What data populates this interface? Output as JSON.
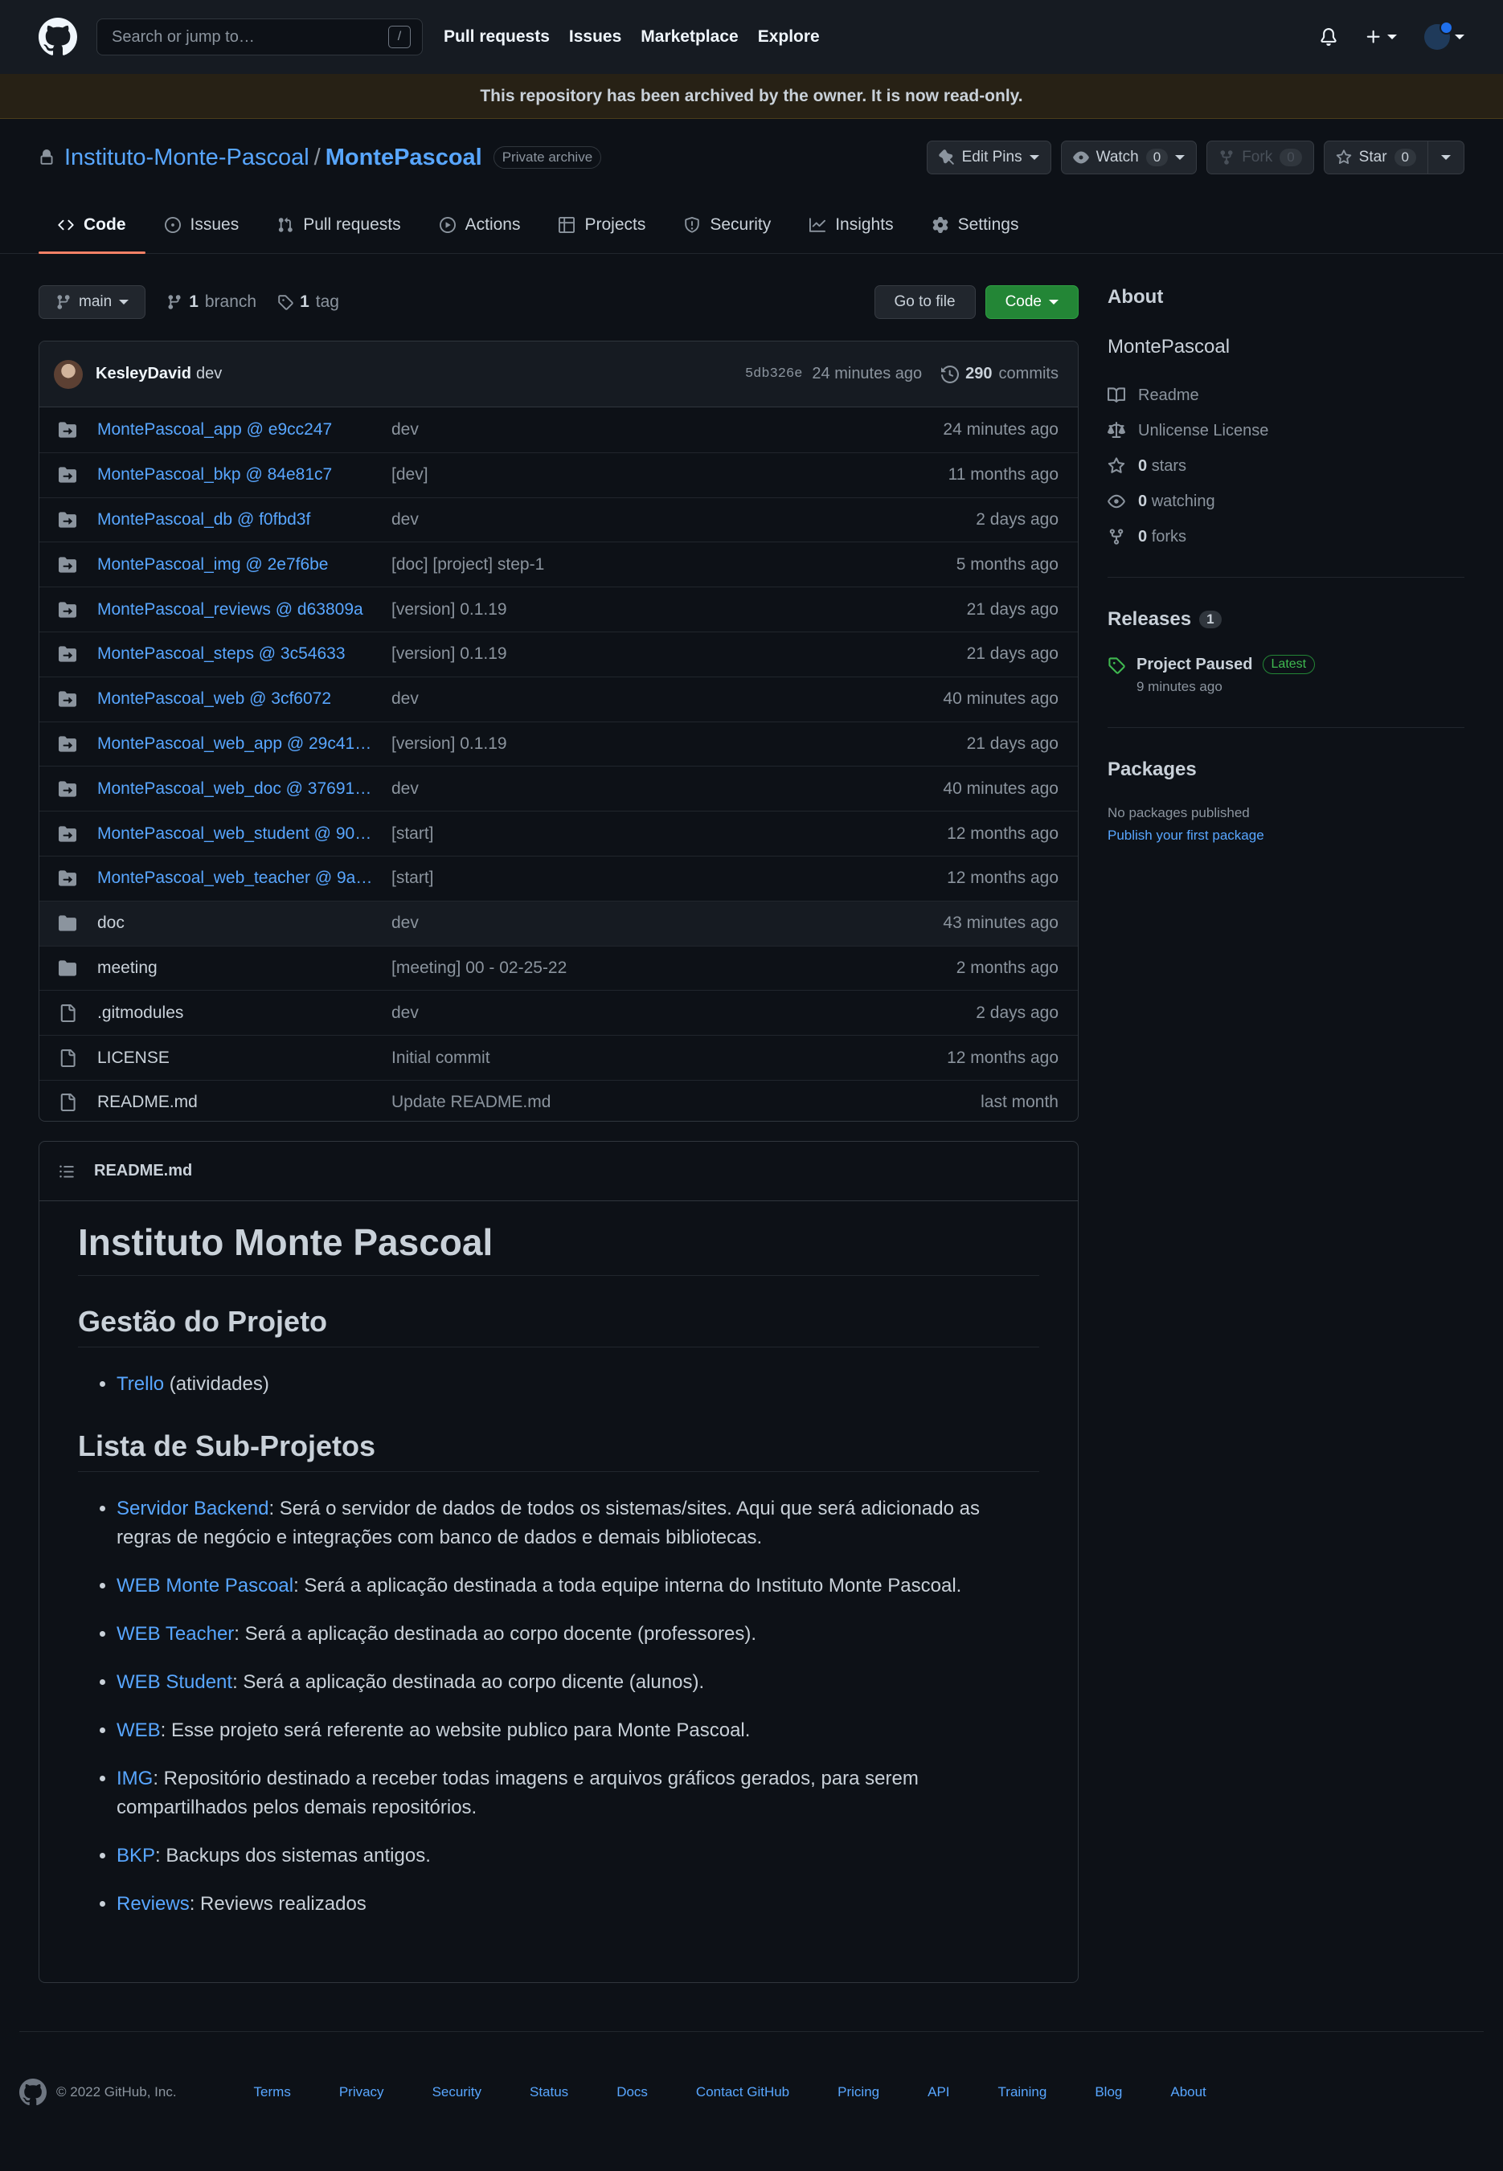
{
  "header": {
    "search_placeholder": "Search or jump to…",
    "search_key": "/",
    "nav": [
      "Pull requests",
      "Issues",
      "Marketplace",
      "Explore"
    ]
  },
  "banner": "This repository has been archived by the owner. It is now read-only.",
  "repo": {
    "owner": "Instituto-Monte-Pascoal",
    "separator": "/",
    "name": "MontePascoal",
    "visibility": "Private archive",
    "edit_pins": "Edit Pins",
    "watch": "Watch",
    "watch_count": "0",
    "fork": "Fork",
    "fork_count": "0",
    "star": "Star",
    "star_count": "0"
  },
  "tabs": [
    "Code",
    "Issues",
    "Pull requests",
    "Actions",
    "Projects",
    "Security",
    "Insights",
    "Settings"
  ],
  "filenav": {
    "branch": "main",
    "branch_count": "1",
    "branch_label": "branch",
    "tag_count": "1",
    "tag_label": "tag",
    "go_to_file": "Go to file",
    "code": "Code"
  },
  "latest_commit": {
    "author": "KesleyDavid",
    "message": "dev",
    "sha": "5db326e",
    "time": "24 minutes ago",
    "commit_count": "290",
    "commit_label": "commits"
  },
  "files": [
    {
      "type": "submodule",
      "name": "MontePascoal_app @ e9cc247",
      "message": "dev",
      "age": "24 minutes ago"
    },
    {
      "type": "submodule",
      "name": "MontePascoal_bkp @ 84e81c7",
      "message": "[dev]",
      "age": "11 months ago"
    },
    {
      "type": "submodule",
      "name": "MontePascoal_db @ f0fbd3f",
      "message": "dev",
      "age": "2 days ago"
    },
    {
      "type": "submodule",
      "name": "MontePascoal_img @ 2e7f6be",
      "message": "[doc] [project] step-1",
      "age": "5 months ago"
    },
    {
      "type": "submodule",
      "name": "MontePascoal_reviews @ d63809a",
      "message": "[version] 0.1.19",
      "age": "21 days ago"
    },
    {
      "type": "submodule",
      "name": "MontePascoal_steps @ 3c54633",
      "message": "[version] 0.1.19",
      "age": "21 days ago"
    },
    {
      "type": "submodule",
      "name": "MontePascoal_web @ 3cf6072",
      "message": "dev",
      "age": "40 minutes ago"
    },
    {
      "type": "submodule",
      "name": "MontePascoal_web_app @ 29c41…",
      "message": "[version] 0.1.19",
      "age": "21 days ago"
    },
    {
      "type": "submodule",
      "name": "MontePascoal_web_doc @ 37691…",
      "message": "dev",
      "age": "40 minutes ago"
    },
    {
      "type": "submodule",
      "name": "MontePascoal_web_student @ 90…",
      "message": "[start]",
      "age": "12 months ago"
    },
    {
      "type": "submodule",
      "name": "MontePascoal_web_teacher @ 9a…",
      "message": "[start]",
      "age": "12 months ago"
    },
    {
      "type": "folder",
      "name": "doc",
      "message": "dev",
      "age": "43 minutes ago"
    },
    {
      "type": "folder",
      "name": "meeting",
      "message": "[meeting] 00 - 02-25-22",
      "age": "2 months ago"
    },
    {
      "type": "file",
      "name": ".gitmodules",
      "message": "dev",
      "age": "2 days ago"
    },
    {
      "type": "file",
      "name": "LICENSE",
      "message": "Initial commit",
      "age": "12 months ago"
    },
    {
      "type": "file",
      "name": "README.md",
      "message": "Update README.md",
      "age": "last month"
    }
  ],
  "readme": {
    "filename": "README.md",
    "h1": "Instituto Monte Pascoal",
    "h2_management": "Gestão do Projeto",
    "management_items": [
      {
        "link": "Trello",
        "text": " (atividades)"
      }
    ],
    "h2_subprojects": "Lista de Sub-Projetos",
    "subprojects": [
      {
        "link": "Servidor Backend",
        "text": ": Será o servidor de dados de todos os sistemas/sites. Aqui que será adicionado as regras de negócio e integrações com banco de dados e demais bibliotecas."
      },
      {
        "link": "WEB Monte Pascoal",
        "text": ": Será a aplicação destinada a toda equipe interna do Instituto Monte Pascoal."
      },
      {
        "link": "WEB Teacher",
        "text": ": Será a aplicação destinada ao corpo docente (professores)."
      },
      {
        "link": "WEB Student",
        "text": ": Será a aplicação destinada ao corpo dicente (alunos)."
      },
      {
        "link": "WEB",
        "text": ": Esse projeto será referente ao website publico para Monte Pascoal."
      },
      {
        "link": "IMG",
        "text": ": Repositório destinado a receber todas imagens e arquivos gráficos gerados, para serem compartilhados pelos demais repositórios."
      },
      {
        "link": "BKP",
        "text": ": Backups dos sistemas antigos."
      },
      {
        "link": "Reviews",
        "text": ": Reviews realizados"
      }
    ]
  },
  "about": {
    "title": "About",
    "description": "MontePascoal",
    "readme": "Readme",
    "license": "Unlicense License",
    "stars_count": "0",
    "stars_label": "stars",
    "watching_count": "0",
    "watching_label": "watching",
    "forks_count": "0",
    "forks_label": "forks"
  },
  "releases": {
    "title": "Releases",
    "count": "1",
    "name": "Project Paused",
    "badge": "Latest",
    "time": "9 minutes ago"
  },
  "packages": {
    "title": "Packages",
    "note": "No packages published",
    "link": "Publish your first package"
  },
  "footer": {
    "copyright": "© 2022 GitHub, Inc.",
    "links": [
      "Terms",
      "Privacy",
      "Security",
      "Status",
      "Docs",
      "Contact GitHub",
      "Pricing",
      "API",
      "Training",
      "Blog",
      "About"
    ]
  },
  "colors": {
    "background": "#0d1117",
    "header": "#161b22",
    "link": "#58a6ff",
    "green_button": "#238636",
    "tab_underline": "#f78166",
    "banner": "#272115"
  }
}
